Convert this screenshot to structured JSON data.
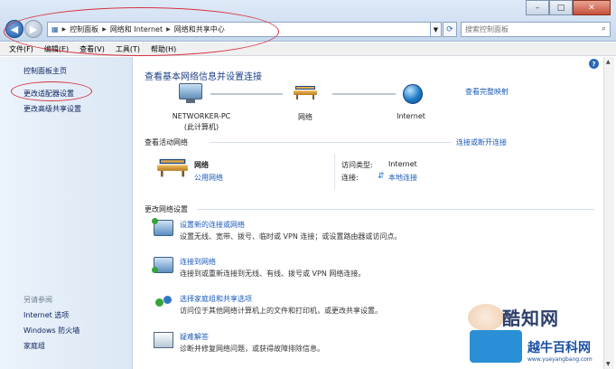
{
  "address_bar": {
    "crumbs": [
      "控制面板",
      "网络和 Internet",
      "网络和共享中心"
    ]
  },
  "search": {
    "placeholder": "搜索控制面板"
  },
  "menu": [
    "文件(F)",
    "编辑(E)",
    "查看(V)",
    "工具(T)",
    "帮助(H)"
  ],
  "sidebar": {
    "links": [
      "控制面板主页",
      "更改适配器设置",
      "更改高级共享设置"
    ],
    "see_also_heading": "另请参阅",
    "see_also": [
      "Internet 选项",
      "Windows 防火墙",
      "家庭组"
    ]
  },
  "main": {
    "title": "查看基本网络信息并设置连接",
    "map_link": "查看完整映射",
    "nodes": [
      {
        "label": "NETWORKER-PC",
        "sublabel": "(此计算机)"
      },
      {
        "label": "网络"
      },
      {
        "label": "Internet"
      }
    ],
    "active_heading": "查看活动网络",
    "active_link": "连接或断开连接",
    "active_network": {
      "name": "网络",
      "type_link": "公用网络",
      "access_label": "访问类型:",
      "access_value": "Internet",
      "connection_label": "连接:",
      "connection_value": "本地连接"
    },
    "change_heading": "更改网络设置",
    "tasks": [
      {
        "link": "设置新的连接或网络",
        "desc": "设置无线、宽带、拨号、临时或 VPN 连接；或设置路由器或访问点。"
      },
      {
        "link": "连接到网络",
        "desc": "连接到或重新连接到无线、有线、拨号或 VPN 网络连接。"
      },
      {
        "link": "选择家庭组和共享选项",
        "desc": "访问位于其他网络计算机上的文件和打印机，或更改共享设置。"
      },
      {
        "link": "疑难解答",
        "desc": "诊断并修复网络问题，或获得故障排除信息。"
      }
    ]
  },
  "watermarks": {
    "top": "酷知网",
    "bottom": "越牛百科网",
    "bottom_url": "www.yueyangbang.com"
  }
}
